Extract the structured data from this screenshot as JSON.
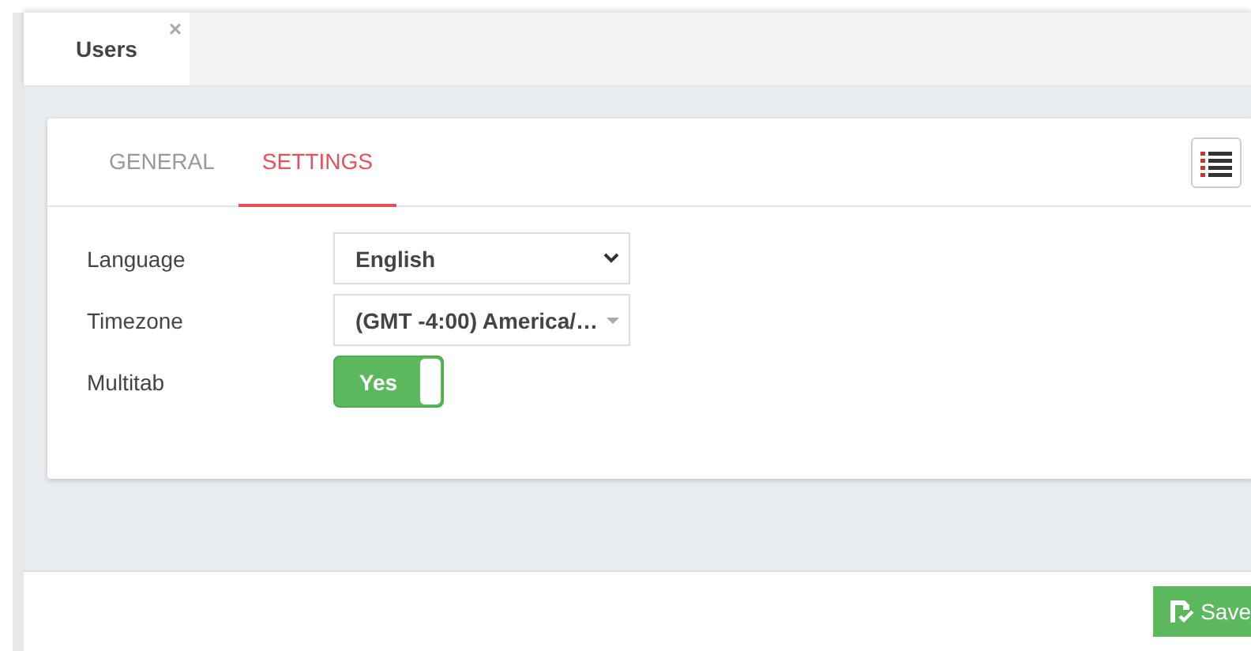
{
  "page_tabs": [
    {
      "label": "Users",
      "selected": true,
      "close": "×"
    }
  ],
  "section_tabs": [
    {
      "label": "GENERAL",
      "selected": false
    },
    {
      "label": "SETTINGS",
      "selected": true
    }
  ],
  "settings": [
    {
      "kind": "select",
      "label": "Language",
      "value": "English"
    },
    {
      "kind": "combobox",
      "label": "Timezone",
      "value": "(GMT -4:00) America/…"
    },
    {
      "kind": "toggle",
      "label": "Multitab",
      "on": true,
      "value": "Yes"
    }
  ],
  "footer": {
    "save_button": "Save"
  }
}
